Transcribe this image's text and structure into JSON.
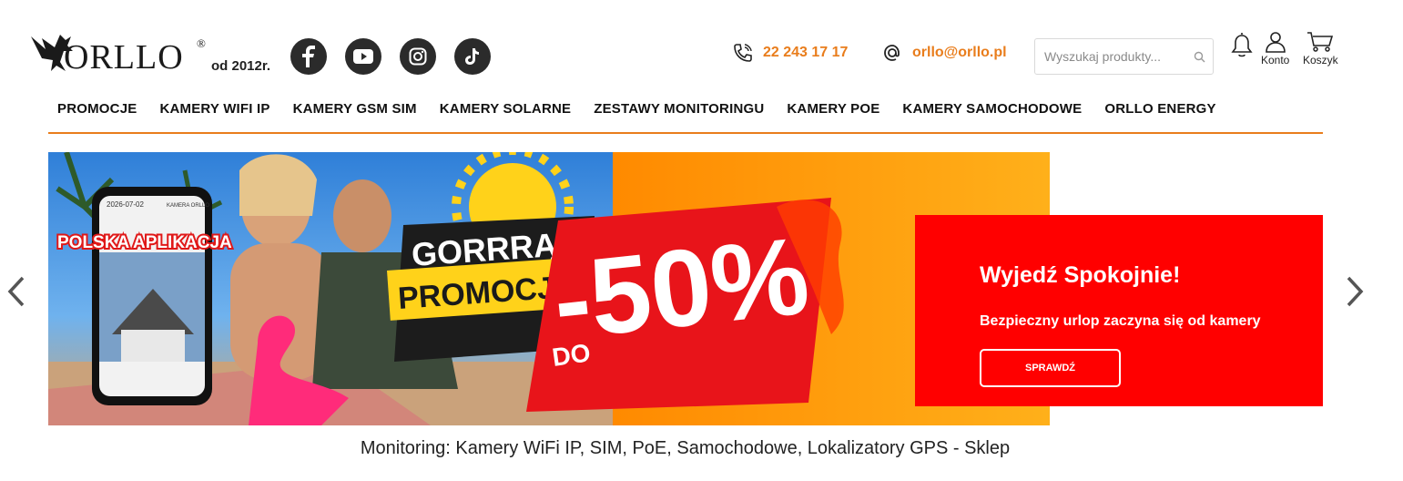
{
  "brand": {
    "name": "ORLLO",
    "registered": "®",
    "since": "od 2012r."
  },
  "social": [
    {
      "icon": "facebook-icon"
    },
    {
      "icon": "youtube-icon"
    },
    {
      "icon": "instagram-icon"
    },
    {
      "icon": "tiktok-icon"
    }
  ],
  "contact": {
    "phone": "22 243 17 17",
    "email": "orllo@orllo.pl"
  },
  "search": {
    "placeholder": "Wyszukaj produkty..."
  },
  "header_icons": {
    "account_label": "Konto",
    "cart_label": "Koszyk"
  },
  "nav": {
    "items": [
      "PROMOCJE",
      "KAMERY WIFI IP",
      "KAMERY GSM SIM",
      "KAMERY SOLARNE",
      "ZESTAWY MONITORINGU",
      "KAMERY POE",
      "KAMERY SAMOCHODOWE",
      "ORLLO ENERGY"
    ]
  },
  "banner": {
    "app_label": "POLSKA APLIKACJA",
    "phone_date": "2026-07-02",
    "phone_camera": "KAMERA ORLLO",
    "headline_1": "GORRRĄCE",
    "headline_2": "PROMOCJE",
    "discount_prefix": "DO",
    "discount": "-50%"
  },
  "promo": {
    "title": "Wyjedź Spokojnie!",
    "subtitle": "Bezpieczny urlop zaczyna się od kamery",
    "button": "SPRAWDŹ"
  },
  "caption": "Monitoring: Kamery WiFi IP, SIM, PoE, Samochodowe, Lokalizatory GPS - Sklep",
  "colors": {
    "accent": "#e97d1c",
    "promo_red": "#ff0000",
    "social_bg": "#2b2b2b"
  }
}
